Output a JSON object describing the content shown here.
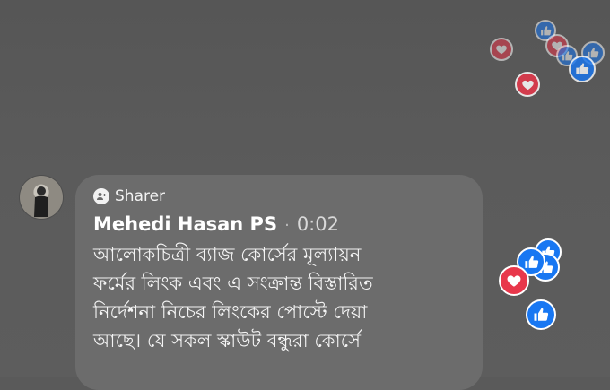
{
  "header": {
    "sharer_label": "Sharer"
  },
  "comment": {
    "author": "Mehedi Hasan PS",
    "separator": "·",
    "timestamp": "0:02",
    "text": "আলোকচিত্রী ব্যাজ কোর্সের মূল্যায়ন\nফর্মের লিংক এবং এ সংক্রান্ত বিস্তারিত\nনির্দেশনা নিচের লিংকের পোস্টে দেয়া\nআছে। যে সকল স্কাউট বন্ধুরা কোর্সে"
  },
  "reactions": {
    "like_icon": "thumbs-up-icon",
    "love_icon": "heart-icon",
    "like_color": "#1877f2",
    "love_color": "#e8374b"
  }
}
